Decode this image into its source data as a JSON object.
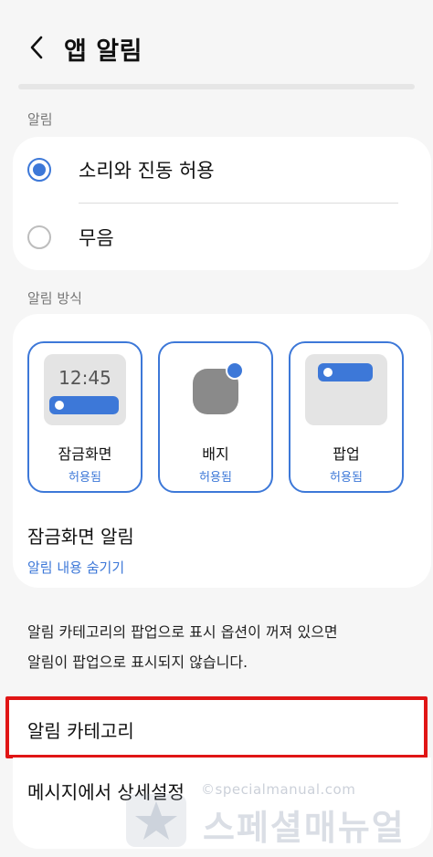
{
  "header": {
    "title": "앱 알림",
    "back_icon": "chevron-left-icon"
  },
  "notifications": {
    "section_label": "알림",
    "options": [
      {
        "label": "소리와 진동 허용",
        "selected": true
      },
      {
        "label": "무음",
        "selected": false
      }
    ]
  },
  "notification_style": {
    "section_label": "알림 방식",
    "styles": [
      {
        "name": "잠금화면",
        "state": "허용됨",
        "preview_time": "12:45"
      },
      {
        "name": "배지",
        "state": "허용됨"
      },
      {
        "name": "팝업",
        "state": "허용됨"
      }
    ],
    "lock_screen": {
      "title": "잠금화면 알림",
      "subtitle": "알림 내용 숨기기"
    }
  },
  "info": {
    "line1": "알림 카테고리의 팝업으로 표시 옵션이 꺼져 있으면",
    "line2": "알림이 팝업으로 표시되지 않습니다."
  },
  "menu": {
    "categories": "알림 카테고리",
    "advanced": "메시지에서 상세설정"
  },
  "watermark": {
    "url": "©specialmanual.com",
    "brand": "스페셜매뉴얼"
  },
  "colors": {
    "accent": "#3d78d8",
    "highlight": "#e01515",
    "background": "#f6f6f6"
  }
}
